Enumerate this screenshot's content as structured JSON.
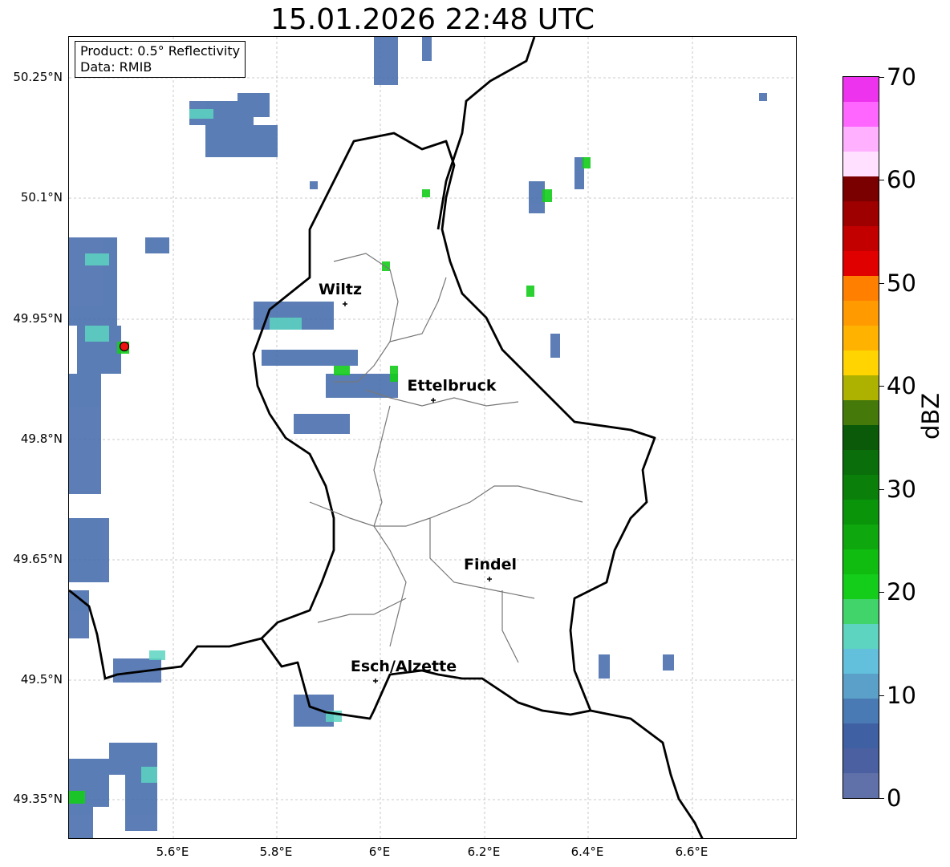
{
  "title": "15.01.2026 22:48 UTC",
  "info": {
    "product": "Product: 0.5° Reflectivity",
    "data": "Data: RMIB"
  },
  "y_ticks": [
    "50.25°N",
    "50.1°N",
    "49.95°N",
    "49.8°N",
    "49.65°N",
    "49.5°N",
    "49.35°N"
  ],
  "x_ticks": [
    "5.6°E",
    "5.8°E",
    "6°E",
    "6.2°E",
    "6.4°E",
    "6.6°E"
  ],
  "cities": [
    {
      "name": "Wiltz"
    },
    {
      "name": "Ettelbruck"
    },
    {
      "name": "Findel"
    },
    {
      "name": "Esch/Alzette"
    }
  ],
  "colorbar": {
    "unit": "dBZ",
    "labels": [
      "70",
      "60",
      "50",
      "40",
      "30",
      "20",
      "10",
      "0"
    ],
    "colors": [
      "#ee33ee",
      "#ff66ff",
      "#ffb0ff",
      "#ffe0ff",
      "#7a0000",
      "#9e0000",
      "#c20000",
      "#e00000",
      "#ff8000",
      "#ff9a00",
      "#ffb300",
      "#ffd400",
      "#adb200",
      "#457a0a",
      "#0a5a0a",
      "#0a6e0a",
      "#0a800a",
      "#0a940a",
      "#0ea80e",
      "#10bc10",
      "#14cc1a",
      "#40d46a",
      "#5cd4c0",
      "#62c0dc",
      "#5aa0c8",
      "#4a7ab4",
      "#4060a4",
      "#4a60a0",
      "#6070a8"
    ]
  },
  "radar_marker_color": "#ee1111"
}
